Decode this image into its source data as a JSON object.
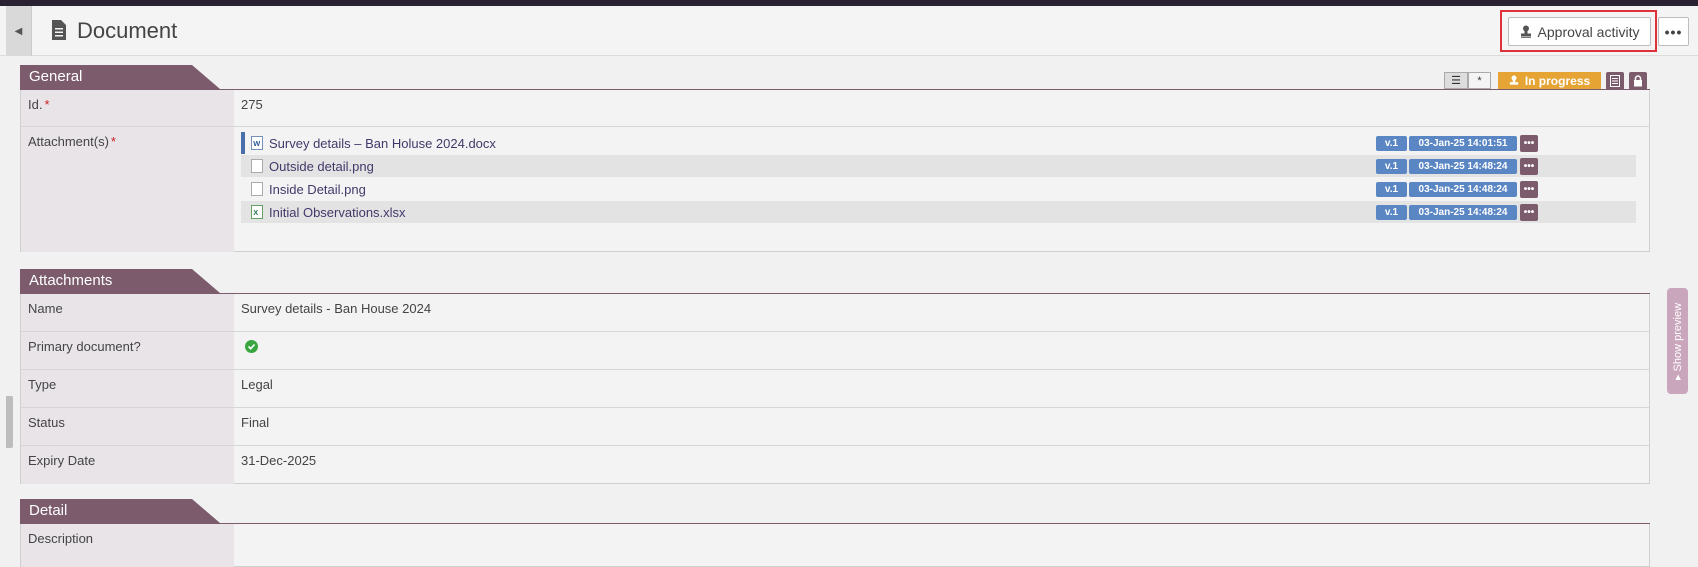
{
  "header": {
    "title": "Document",
    "approval_label": "Approval activity",
    "more_label": "•••"
  },
  "sections": {
    "general": "General",
    "attachments": "Attachments",
    "detail": "Detail"
  },
  "status_toolbar": {
    "view_list_icon": "list-icon",
    "asterisk_label": "*",
    "status": "In progress",
    "status_color": "#e6a434"
  },
  "general": {
    "id_label": "Id.",
    "id_value": "275",
    "attachments_label": "Attachment(s)",
    "required_mark": "*",
    "files": [
      {
        "name": "Survey details – Ban Holuse 2024.docx",
        "version": "v.1",
        "date": "03-Jan-25 14:01:51",
        "icon": "word-file-icon"
      },
      {
        "name": "Outside detail.png",
        "version": "v.1",
        "date": "03-Jan-25 14:48:24",
        "icon": "file-icon"
      },
      {
        "name": "Inside Detail.png",
        "version": "v.1",
        "date": "03-Jan-25 14:48:24",
        "icon": "file-icon"
      },
      {
        "name": "Initial Observations.xlsx",
        "version": "v.1",
        "date": "03-Jan-25 14:48:24",
        "icon": "excel-file-icon"
      }
    ],
    "file_more_label": "•••"
  },
  "attachments": {
    "name_label": "Name",
    "name_value": "Survey details - Ban House 2024",
    "primary_label": "Primary document?",
    "type_label": "Type",
    "type_value": "Legal",
    "status_label": "Status",
    "status_value": "Final",
    "expiry_label": "Expiry Date",
    "expiry_value": "31-Dec-2025"
  },
  "detail": {
    "description_label": "Description"
  },
  "preview": {
    "label": "▸ Show preview"
  },
  "colors": {
    "accent": "#7b5b6c",
    "badge_blue": "#5a86c4",
    "highlight": "#e0303a"
  }
}
